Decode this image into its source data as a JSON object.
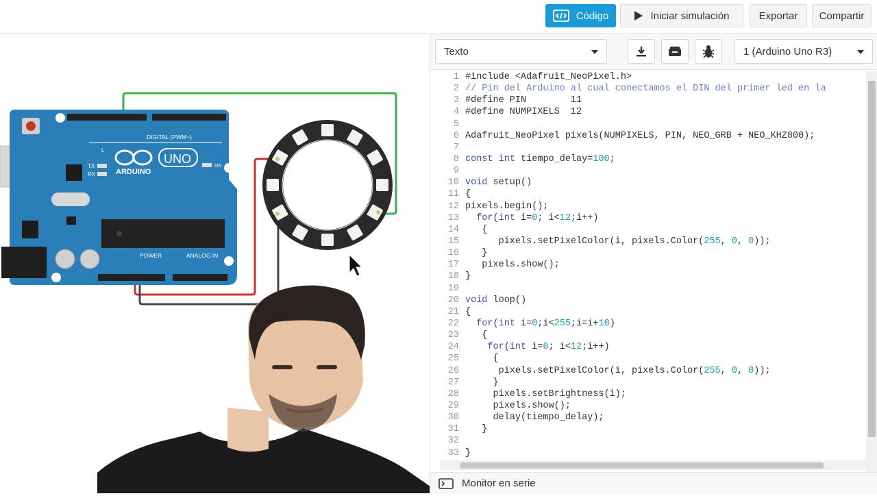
{
  "toolbar": {
    "code_label": "Código",
    "simulate_label": "Iniciar simulación",
    "export_label": "Exportar",
    "share_label": "Compartir"
  },
  "editor_toolbar": {
    "mode_select": "Texto",
    "device_select": "1 (Arduino Uno R3)"
  },
  "board": {
    "logo_text": "ARDUINO",
    "model_text": "UNO",
    "digital_label": "DIGITAL (PWM~)",
    "power_label": "POWER",
    "analog_label": "ANALOG IN",
    "led_labels": [
      "L",
      "TX",
      "RX"
    ],
    "on_label": "ON"
  },
  "editor": {
    "lines": [
      "#include <Adafruit_NeoPixel.h>",
      "// Pin del Arduino al cual conectamos el DIN del primer led en la",
      "#define PIN        11",
      "#define NUMPIXELS  12",
      "",
      "Adafruit_NeoPixel pixels(NUMPIXELS, PIN, NEO_GRB + NEO_KHZ800);",
      "",
      "const int tiempo_delay=100;",
      "",
      "void setup()",
      "{",
      "pixels.begin();",
      "  for(int i=0; i<12;i++)",
      "   {",
      "      pixels.setPixelColor(i, pixels.Color(255, 0, 0));",
      "   }",
      "   pixels.show();",
      "}",
      "",
      "void loop()",
      "{",
      "  for(int i=0;i<255;i=i+10)",
      "   {",
      "    for(int i=0; i<12;i++)",
      "     {",
      "      pixels.setPixelColor(i, pixels.Color(255, 0, 0));",
      "     }",
      "     pixels.setBrightness(i);",
      "     pixels.show();",
      "     delay(tiempo_delay);",
      "   }",
      "",
      "}"
    ]
  },
  "footer": {
    "serial_monitor_label": "Monitor en serie"
  },
  "colors": {
    "accent": "#1a9ad6",
    "board": "#2b7fb8",
    "wire_green": "#3ab14a",
    "wire_red": "#d0312d",
    "wire_black": "#444444"
  }
}
